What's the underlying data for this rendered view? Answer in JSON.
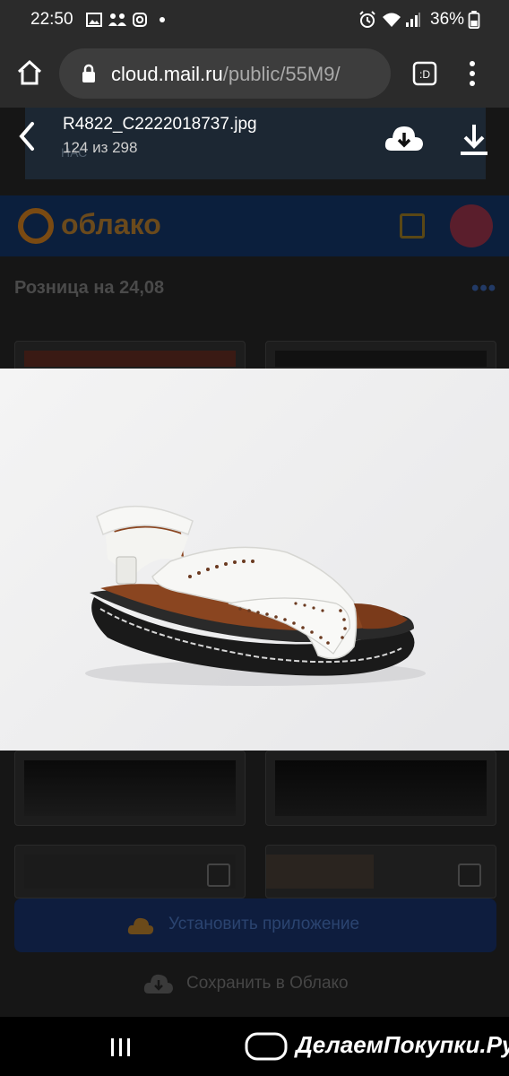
{
  "status_bar": {
    "time": "22:50",
    "battery": "36%",
    "icons": [
      "image-icon",
      "people-icon",
      "instagram-icon",
      "dot-icon",
      "alarm-icon",
      "wifi-icon",
      "signal-icon",
      "battery-icon"
    ]
  },
  "browser": {
    "url_host": "cloud.mail.ru",
    "url_path": "/public/55M9/",
    "icons": [
      "home-icon",
      "lock-icon",
      "tab-switcher-icon",
      "menu-dots-icon"
    ]
  },
  "viewer": {
    "file_name": "R4822_C2222018737.jpg",
    "counter": "124 из 298",
    "icons": [
      "back-chevron-icon",
      "cloud-download-icon",
      "download-icon"
    ]
  },
  "background_page": {
    "banner_text": "НАС",
    "logo_text": "облако",
    "folder_title": "Розница на 24,08",
    "install_button": "Установить приложение",
    "save_button": "Сохранить в Облако"
  },
  "nav_bar": {
    "icons": [
      "recent-apps-icon",
      "home-pill-icon"
    ],
    "watermark": "ДелаемПокупки.Ру"
  },
  "colors": {
    "chrome_bg": "#2b2b2b",
    "url_pill": "#3d3d3d",
    "photo_bg": "#efefef",
    "sandal_white": "#f7f7f5",
    "insole_brown": "#8a4520",
    "sole_black": "#1a1a1a"
  }
}
